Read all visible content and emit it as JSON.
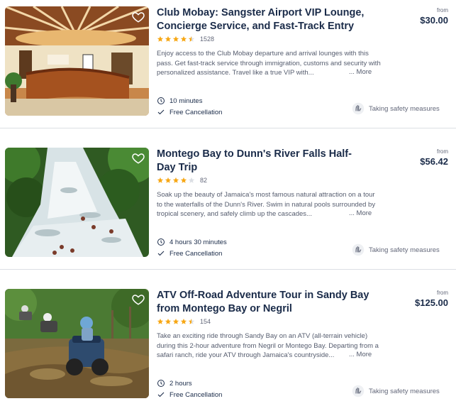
{
  "listings": [
    {
      "title": "Club Mobay: Sangster Airport VIP Lounge, Concierge Service, and Fast-Track Entry",
      "rating": 4.5,
      "review_count": "1528",
      "description": "Enjoy access to the Club Mobay departure and arrival lounges with this pass. Get fast-track service through immigration, customs and security with personalized assistance. Travel like a true VIP with...",
      "more_label": "... More",
      "duration": "10 minutes",
      "cancellation": "Free Cancellation",
      "safety": "Taking safety measures",
      "from_label": "from",
      "price": "$30.00",
      "image_icon": "lounge-photo"
    },
    {
      "title": "Montego Bay to Dunn's River Falls Half-Day Trip",
      "rating": 4.0,
      "review_count": "82",
      "description": "Soak up the beauty of Jamaica's most famous natural attraction on a tour to the waterfalls of the Dunn's River. Swim in natural pools surrounded by tropical scenery, and safely climb up the cascades...",
      "more_label": "... More",
      "duration": "4 hours 30 minutes",
      "cancellation": "Free Cancellation",
      "safety": "Taking safety measures",
      "from_label": "from",
      "price": "$56.42",
      "image_icon": "waterfall-photo"
    },
    {
      "title": "ATV Off-Road Adventure Tour in Sandy Bay from Montego Bay or Negril",
      "rating": 4.5,
      "review_count": "154",
      "description": "Take an exciting ride through Sandy Bay on an ATV (all-terrain vehicle) during this 2-hour adventure from Negril or Montego Bay. Departing from a safari ranch, ride your ATV through Jamaica's countryside...",
      "more_label": "... More",
      "duration": "2 hours",
      "cancellation": "Free Cancellation",
      "safety": "Taking safety measures",
      "from_label": "from",
      "price": "$125.00",
      "image_icon": "atv-photo"
    }
  ],
  "colors": {
    "star": "#f7a816",
    "star_empty": "#dcdfe4",
    "text": "#1a2b49",
    "muted": "#63687a"
  }
}
